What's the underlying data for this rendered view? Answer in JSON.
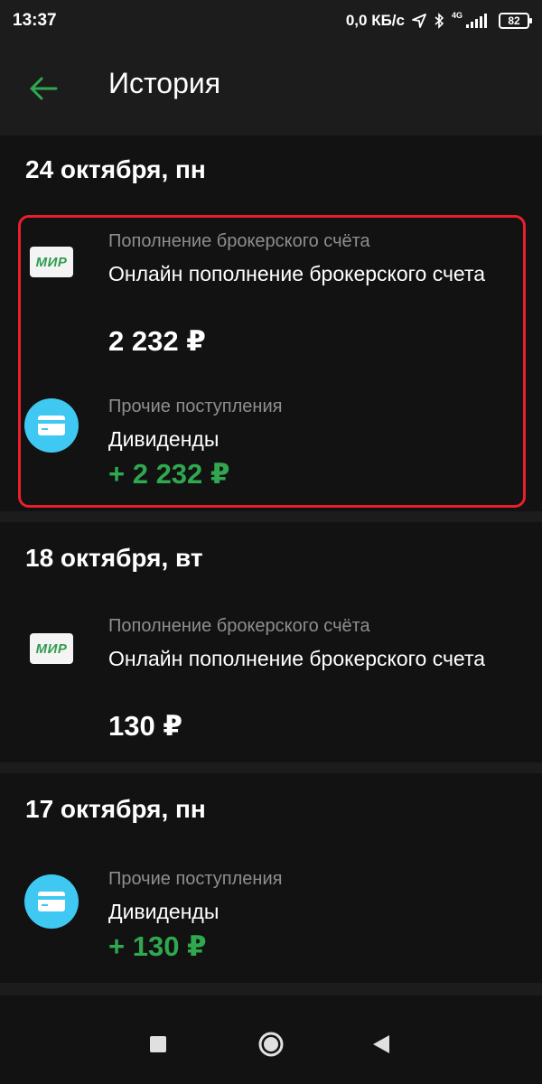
{
  "status_bar": {
    "time": "13:37",
    "net_speed": "0,0 КБ/с",
    "network_type": "4G",
    "battery": "82"
  },
  "header": {
    "title": "История",
    "back_icon": "arrow-left-icon"
  },
  "colors": {
    "accent_green": "#2fa84f",
    "highlight_red": "#e8202d",
    "card_icon_blue": "#3fc8f2"
  },
  "groups": [
    {
      "date": "24 октября, пн",
      "transactions": [
        {
          "icon": "mir-card-icon",
          "category": "Пополнение брокерского счёта",
          "name": "Онлайн пополнение брокерского счета",
          "amount": "2 232 ₽"
        },
        {
          "icon": "card-icon",
          "category": "Прочие поступления",
          "name": "Дивиденды",
          "amount": "+ 2 232 ₽"
        }
      ]
    },
    {
      "date": "18 октября, вт",
      "transactions": [
        {
          "icon": "mir-card-icon",
          "category": "Пополнение брокерского счёта",
          "name": "Онлайн пополнение брокерского счета",
          "amount": "130 ₽"
        }
      ]
    },
    {
      "date": "17 октября, пн",
      "transactions": [
        {
          "icon": "card-icon",
          "category": "Прочие поступления",
          "name": "Дивиденды",
          "amount": "+ 130 ₽"
        }
      ]
    }
  ],
  "mir_logo_text": "МИР",
  "nav": {
    "recents_icon": "square-icon",
    "home_icon": "circle-icon",
    "back_icon": "triangle-back-icon"
  }
}
